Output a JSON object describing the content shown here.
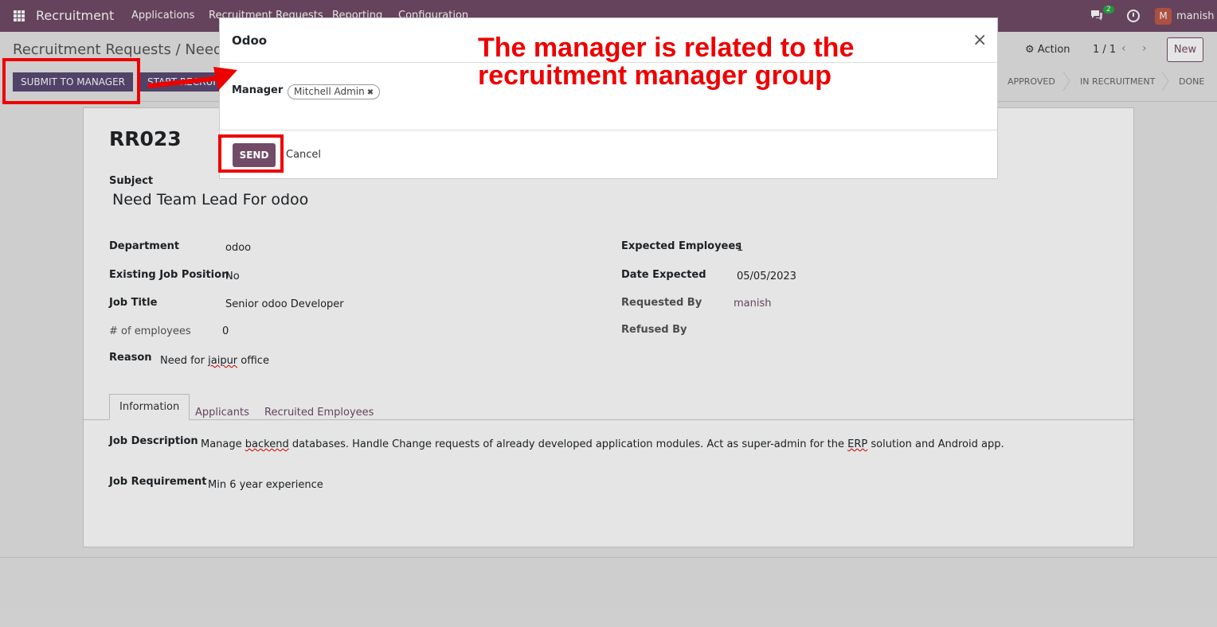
{
  "navbar": {
    "app_name": "Recruitment",
    "menu": [
      "Applications",
      "Recruitment Requests",
      "Reporting",
      "Configuration"
    ],
    "chat_badge": "2",
    "avatar_letter": "M",
    "username": "manish"
  },
  "control_panel": {
    "breadcrumb": "Recruitment Requests / Need T",
    "buttons": {
      "submit": "SUBMIT TO MANAGER",
      "start": "START RECRUI"
    },
    "action_label": "Action",
    "pager": "1 / 1",
    "pager_arrows": "‹ ›",
    "new_label": "New",
    "status": [
      "APPROVED",
      "IN RECRUITMENT",
      "DONE"
    ]
  },
  "record": {
    "name": "RR023",
    "subject_label": "Subject",
    "subject": "Need Team Lead For odoo",
    "left_fields": [
      {
        "label": "Department",
        "value": "odoo"
      },
      {
        "label": "Existing Job Position",
        "value": "No"
      },
      {
        "label": "Job Title",
        "value": "Senior odoo Developer"
      },
      {
        "label": "# of employees",
        "value": "0"
      },
      {
        "label": "Reason",
        "value_pre": "Need for ",
        "value_err": "jaipur",
        "value_post": " office"
      }
    ],
    "right_fields": [
      {
        "label": "Expected Employees",
        "value": "1"
      },
      {
        "label": "Date Expected",
        "value": "05/05/2023"
      },
      {
        "label": "Requested By",
        "value": "manish"
      },
      {
        "label": "Refused By",
        "value": ""
      }
    ],
    "tabs": [
      "Information",
      "Applicants",
      "Recruited Employees"
    ],
    "job_description_label": "Job Description",
    "job_description": {
      "p1": "Manage ",
      "err1": "backend",
      "p2": " databases. Handle Change requests of already developed application modules. Act as super-admin for the ",
      "err2": "ERP",
      "p3": " solution and Android app."
    },
    "job_requirement_label": "Job Requirement",
    "job_requirement": "Min 6 year experience"
  },
  "modal": {
    "title": "Odoo",
    "close_icon": "×",
    "manager_label": "Manager",
    "manager_tag": "Mitchell Admin",
    "tag_remove_icon": "✖",
    "send_label": "SEND",
    "cancel_label": "Cancel"
  },
  "annotation": {
    "line1": "The manager is related to the",
    "line2": "recruitment manager group"
  },
  "colors": {
    "brand": "#714b67",
    "annotation": "#ee0000"
  }
}
